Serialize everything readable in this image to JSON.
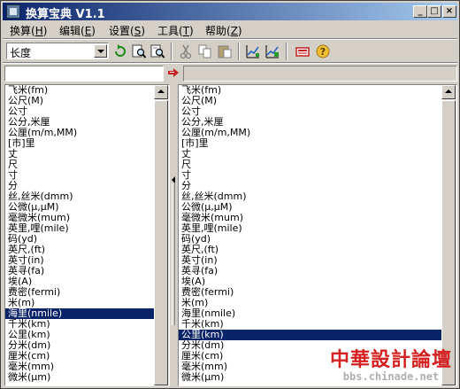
{
  "window": {
    "title": "换算宝典 V1.1"
  },
  "title_buttons": {
    "minimize": "_",
    "maximize": "□",
    "close": "×"
  },
  "menu": [
    {
      "label": "换算(",
      "key": "H",
      "tail": ")"
    },
    {
      "label": "编辑(",
      "key": "E",
      "tail": ")"
    },
    {
      "label": "设置(",
      "key": "S",
      "tail": ")"
    },
    {
      "label": "工具(",
      "key": "T",
      "tail": ")"
    },
    {
      "label": "帮助(",
      "key": "Z",
      "tail": ")"
    }
  ],
  "toolbar": {
    "category": "长度",
    "icons": [
      "refresh-icon",
      "find-icon",
      "find-next-icon",
      "cut-icon",
      "copy-icon",
      "paste-icon",
      "chart-icon",
      "chart-edit-icon",
      "calculator-icon",
      "help-icon"
    ]
  },
  "input": {
    "value": "",
    "result": ""
  },
  "left_list": {
    "items": [
      "飞米(fm)",
      "公尺(M)",
      "公寸",
      "公分,米厘",
      "公厘(m/m,MM)",
      "[市]里",
      "丈",
      "尺",
      "寸",
      "分",
      "丝,丝米(dmm)",
      "公微(μ,μM)",
      "毫微米(mum)",
      "英里,哩(mile)",
      "码(yd)",
      "英尺,(ft)",
      "英寸(in)",
      "英寻(fa)",
      "埃(A)",
      "费密(fermi)",
      "米(m)",
      "海里(nmile)",
      "千米(km)",
      "公里(km)",
      "分米(dm)",
      "厘米(cm)",
      "毫米(mm)",
      "微米(μm)"
    ],
    "selected": 21
  },
  "right_list": {
    "items": [
      "飞米(fm)",
      "公尺(M)",
      "公寸",
      "公分,米厘",
      "公厘(m/m,MM)",
      "[市]里",
      "丈",
      "尺",
      "寸",
      "分",
      "丝,丝米(dmm)",
      "公微(μ,μM)",
      "毫微米(mum)",
      "英里,哩(mile)",
      "码(yd)",
      "英尺,(ft)",
      "英寸(in)",
      "英寻(fa)",
      "埃(A)",
      "费密(fermi)",
      "米(m)",
      "海里(nmile)",
      "千米(km)",
      "公里(km)",
      "分米(dm)",
      "厘米(cm)",
      "毫米(mm)",
      "微米(μm)"
    ],
    "selected": 23
  },
  "watermark": {
    "title": "中華設計論壇",
    "url": "bbs.chinade.net"
  },
  "colors": {
    "titlebar": "#0a246a",
    "selection": "#0a246a",
    "face": "#d4d0c8",
    "watermark": "#d42020"
  }
}
